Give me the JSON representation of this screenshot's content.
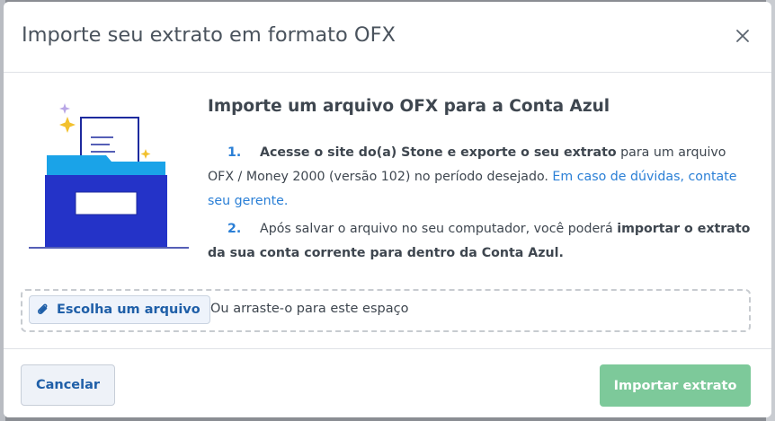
{
  "modal": {
    "title": "Importe seu extrato em formato OFX",
    "close_icon": "close-icon"
  },
  "content": {
    "title": "Importe um arquivo OFX para a Conta Azul",
    "step1": {
      "number": "1.",
      "bold": "Acesse o site do(a) Stone e exporte o seu extrato",
      "text": " para um arquivo OFX / Money 2000 (versão 102) no período desejado. ",
      "link": "Em caso de dúvidas, contate seu gerente."
    },
    "step2": {
      "number": "2.",
      "text": "Após salvar o arquivo no seu computador, você poderá ",
      "bold": "importar o extrato da sua conta corrente para dentro da Conta Azul."
    }
  },
  "dropzone": {
    "button_label": "Escolha um arquivo",
    "button_icon": "paperclip-icon",
    "hint": "Ou arraste-o para este espaço"
  },
  "footer": {
    "cancel_label": "Cancelar",
    "import_label": "Importar extrato"
  },
  "colors": {
    "accent": "#2a7fd6",
    "primary_disabled": "#7dc99a",
    "folder": "#2433c8",
    "folder_tab": "#1aa3e8"
  }
}
